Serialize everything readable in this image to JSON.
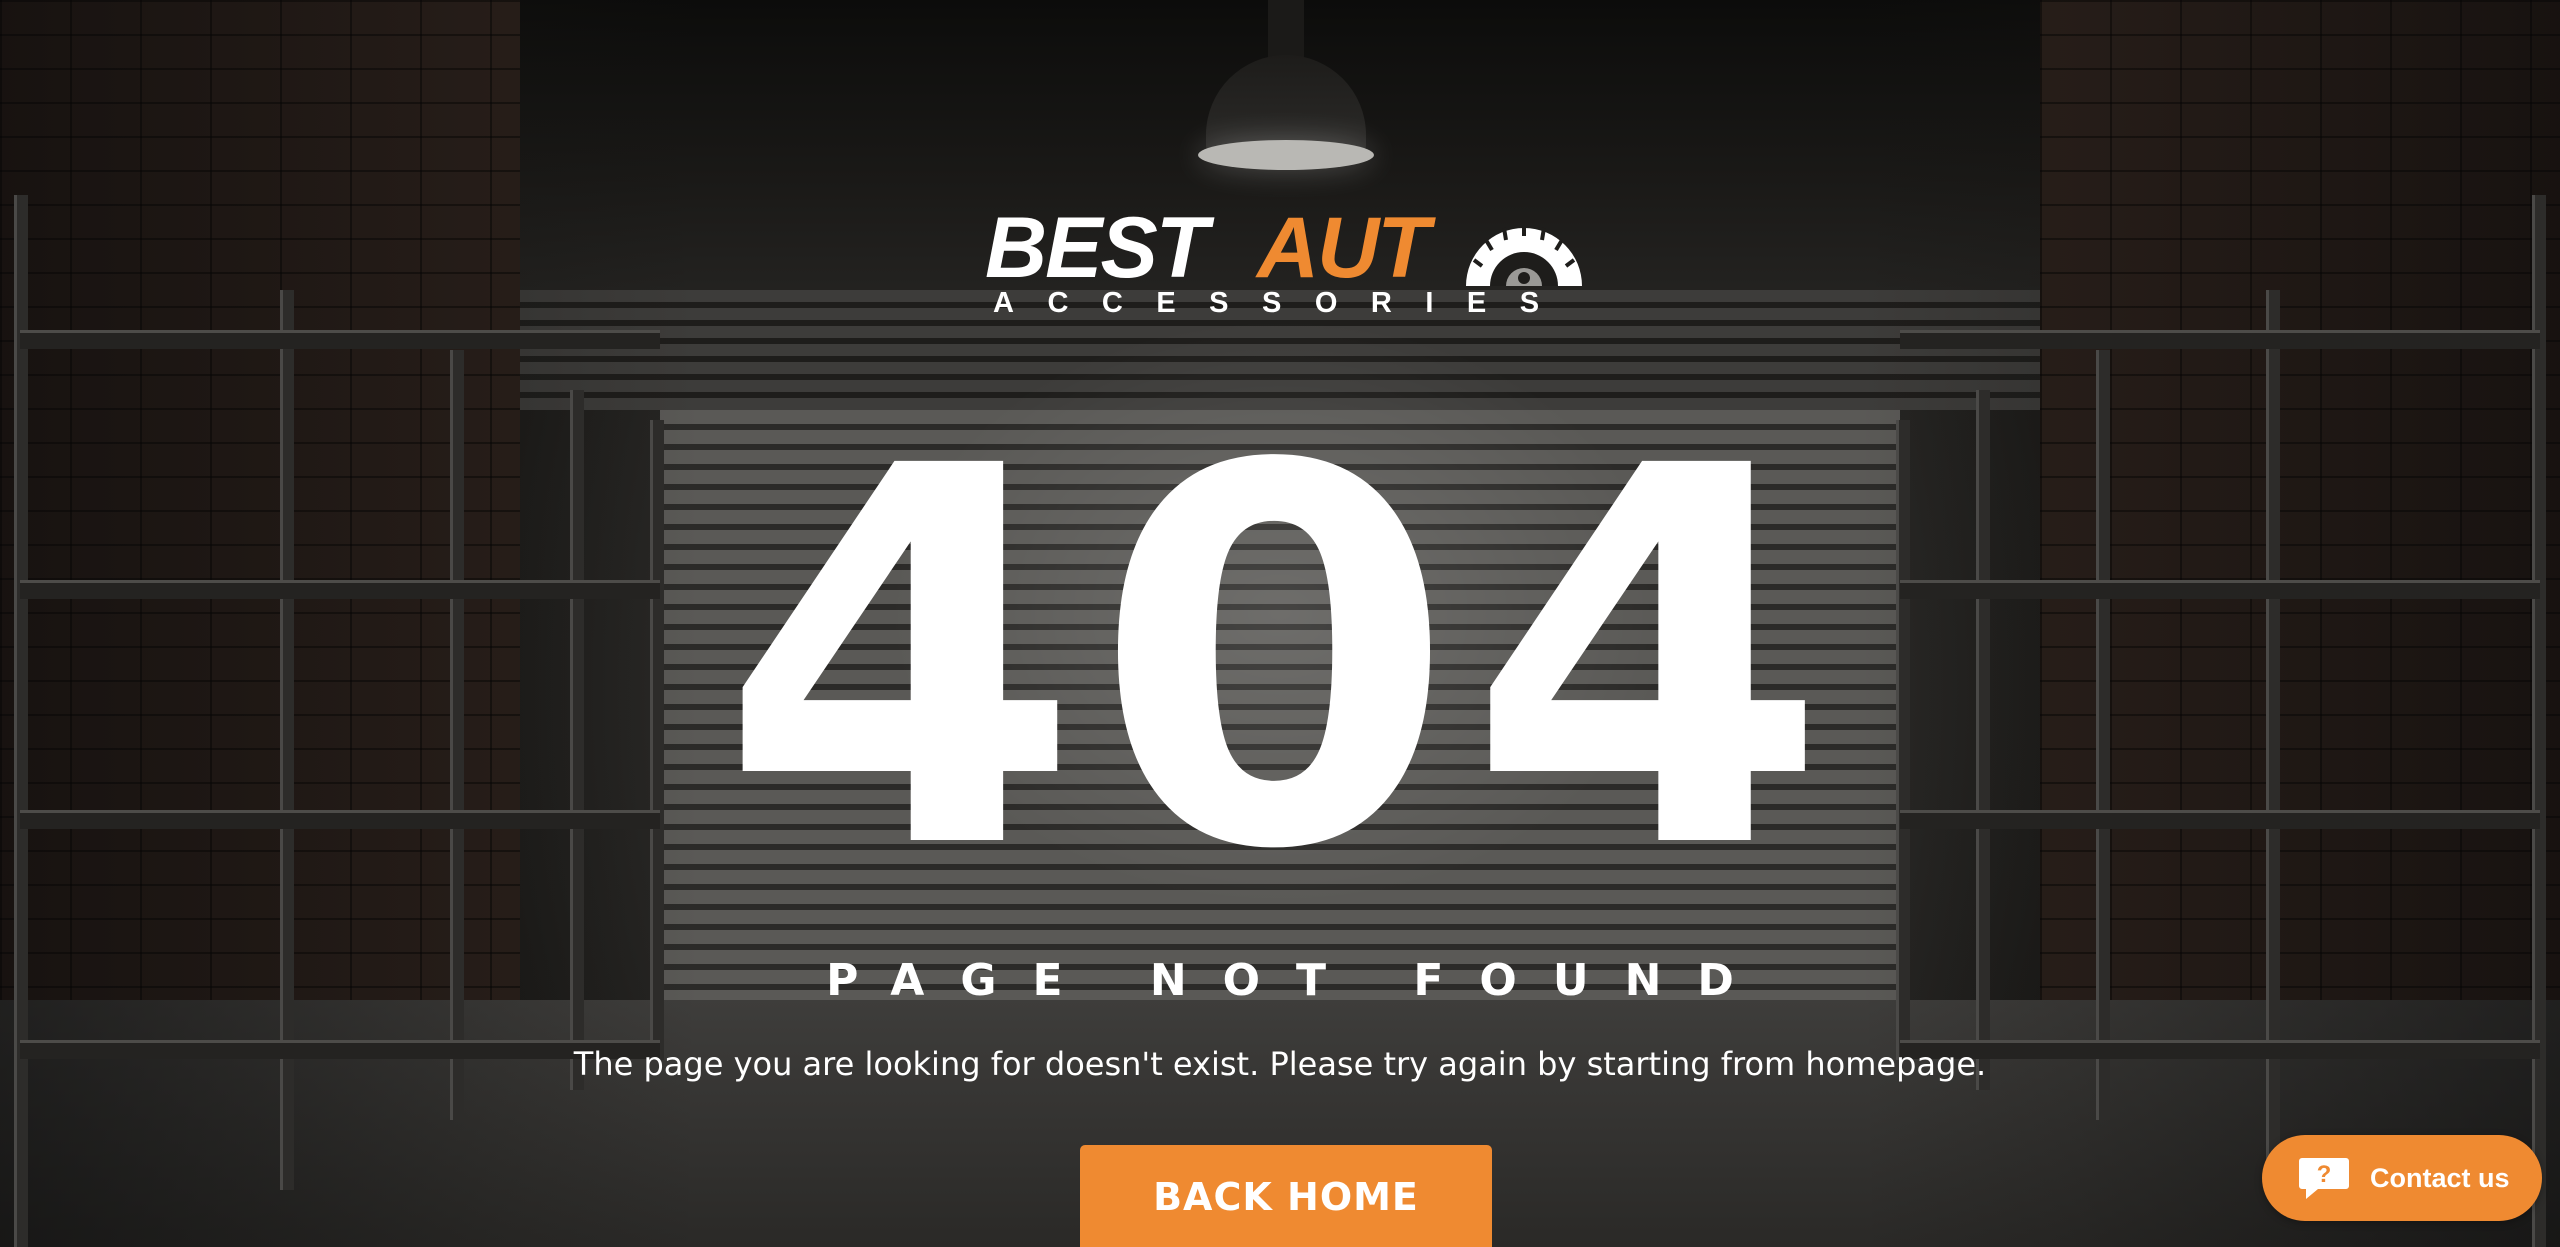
{
  "brand": {
    "name_part1": "BEST",
    "name_part2": "AUT",
    "tagline": "ACCESSORIES",
    "accent_color": "#ef8a31"
  },
  "error": {
    "code": "404",
    "title": "PAGE NOT FOUND",
    "message": "The page you are looking for doesn't exist. Please try again by starting from homepage."
  },
  "actions": {
    "back_home_label": "BACK HOME"
  },
  "chat_widget": {
    "label": "Contact us",
    "icon": "question-speech-bubble-icon"
  }
}
